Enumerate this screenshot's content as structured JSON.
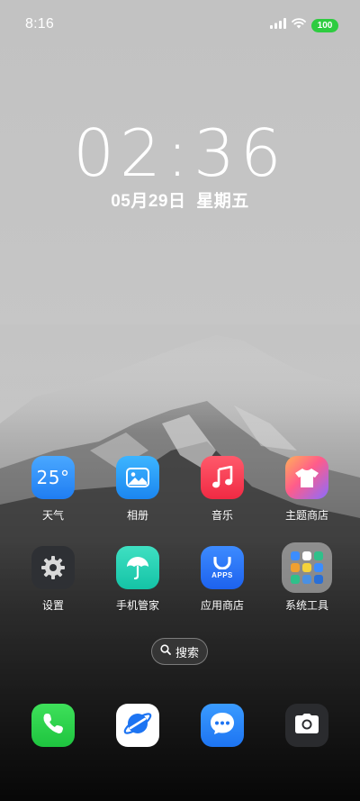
{
  "status_bar": {
    "time": "8:16",
    "battery_level": "100",
    "battery_color": "#2ecc40"
  },
  "lock_clock": {
    "time": "02:36",
    "date_day": "05月29日",
    "weekday": "星期五"
  },
  "apps": [
    {
      "label": "天气",
      "icon": "weather-icon",
      "badge_text": "25°"
    },
    {
      "label": "相册",
      "icon": "gallery-icon"
    },
    {
      "label": "音乐",
      "icon": "music-icon"
    },
    {
      "label": "主题商店",
      "icon": "theme-store-icon"
    },
    {
      "label": "设置",
      "icon": "gear-icon"
    },
    {
      "label": "手机管家",
      "icon": "umbrella-icon"
    },
    {
      "label": "应用商店",
      "icon": "app-store-icon",
      "badge_text": "APPS"
    },
    {
      "label": "系统工具",
      "icon": "folder-icon"
    }
  ],
  "search": {
    "label": "搜索",
    "icon": "search-icon"
  },
  "dock": [
    {
      "name": "phone",
      "icon": "phone-icon",
      "color": "#1ec43f"
    },
    {
      "name": "browser",
      "icon": "browser-icon",
      "color": "#1d74f2"
    },
    {
      "name": "messages",
      "icon": "chat-bubble-icon",
      "color": "#1d74f2"
    },
    {
      "name": "camera",
      "icon": "camera-icon",
      "color": "#2a2b2e"
    }
  ]
}
